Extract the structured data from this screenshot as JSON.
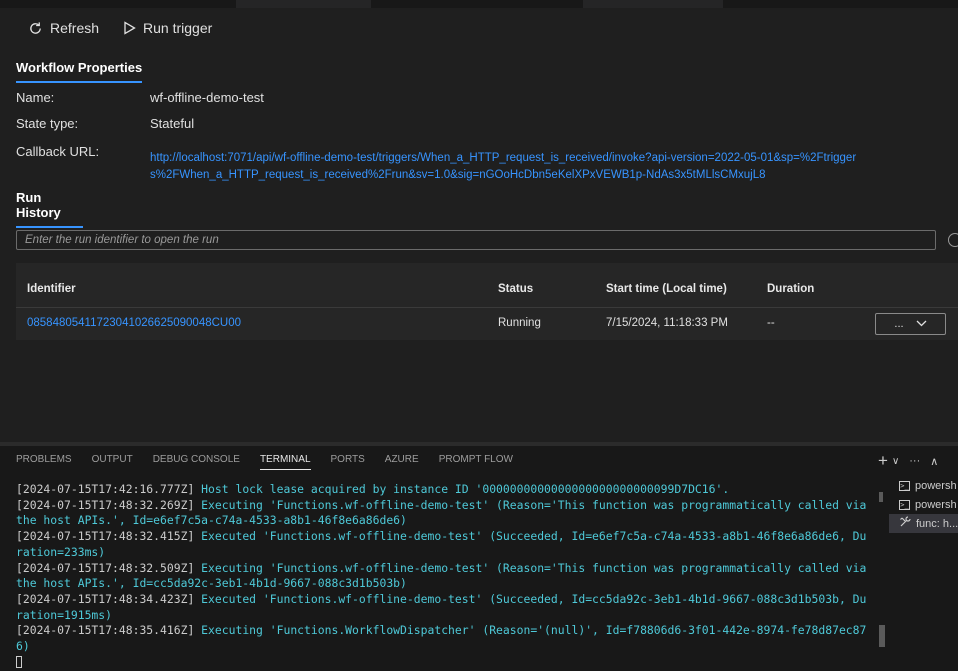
{
  "toolbar": {
    "refresh_label": "Refresh",
    "run_trigger_label": "Run trigger"
  },
  "workflow_properties": {
    "title": "Workflow Properties",
    "name_label": "Name:",
    "name_value": "wf-offline-demo-test",
    "state_type_label": "State type:",
    "state_type_value": "Stateful",
    "callback_label": "Callback URL:",
    "callback_url": "http://localhost:7071/api/wf-offline-demo-test/triggers/When_a_HTTP_request_is_received/invoke?api-version=2022-05-01&sp=%2Ftriggers%2FWhen_a_HTTP_request_is_received%2Frun&sv=1.0&sig=nGOoHcDbn5eKelXPxVEWB1p-NdAs3x5tMLlsCMxujL8"
  },
  "run_history": {
    "title": "Run History",
    "search_placeholder": "Enter the run identifier to open the run",
    "columns": {
      "identifier": "Identifier",
      "status": "Status",
      "start_time": "Start time (Local time)",
      "duration": "Duration"
    },
    "rows": [
      {
        "identifier": "08584805411723041026625090048CU00",
        "status": "Running",
        "start_time": "7/15/2024, 11:18:33 PM",
        "duration": "--",
        "actions_label": "..."
      }
    ]
  },
  "panel": {
    "tabs": [
      "PROBLEMS",
      "OUTPUT",
      "DEBUG CONSOLE",
      "TERMINAL",
      "PORTS",
      "AZURE",
      "PROMPT FLOW"
    ],
    "active_tab": "TERMINAL",
    "actions": {
      "new_terminal": "+",
      "dropdown": "∨",
      "more": "···",
      "maximize": "∧"
    }
  },
  "terminal": {
    "lines": [
      {
        "ts": "[2024-07-15T17:42:16.777Z]",
        "msg": " Host lock lease acquired by instance ID '0000000000000000000000000099D7DC16'."
      },
      {
        "ts": "[2024-07-15T17:48:32.269Z]",
        "msg": " Executing 'Functions.wf-offline-demo-test' (Reason='This function was programmatically called via the host APIs.', Id=e6ef7c5a-c74a-4533-a8b1-46f8e6a86de6)"
      },
      {
        "ts": "[2024-07-15T17:48:32.415Z]",
        "msg": " Executed 'Functions.wf-offline-demo-test' (Succeeded, Id=e6ef7c5a-c74a-4533-a8b1-46f8e6a86de6, Duration=233ms)"
      },
      {
        "ts": "[2024-07-15T17:48:32.509Z]",
        "msg": " Executing 'Functions.wf-offline-demo-test' (Reason='This function was programmatically called via the host APIs.', Id=cc5da92c-3eb1-4b1d-9667-088c3d1b503b)"
      },
      {
        "ts": "[2024-07-15T17:48:34.423Z]",
        "msg": " Executed 'Functions.wf-offline-demo-test' (Succeeded, Id=cc5da92c-3eb1-4b1d-9667-088c3d1b503b, Duration=1915ms)"
      },
      {
        "ts": "[2024-07-15T17:48:35.416Z]",
        "msg": " Executing 'Functions.WorkflowDispatcher' (Reason='(null)', Id=f78806d6-3f01-442e-8974-fe78d87ec876)"
      }
    ]
  },
  "terminal_list": {
    "items": [
      {
        "icon": "terminal-icon",
        "label": "powersh"
      },
      {
        "icon": "terminal-icon",
        "label": "powersh"
      },
      {
        "icon": "tools-icon",
        "label": "func: h..."
      }
    ]
  }
}
